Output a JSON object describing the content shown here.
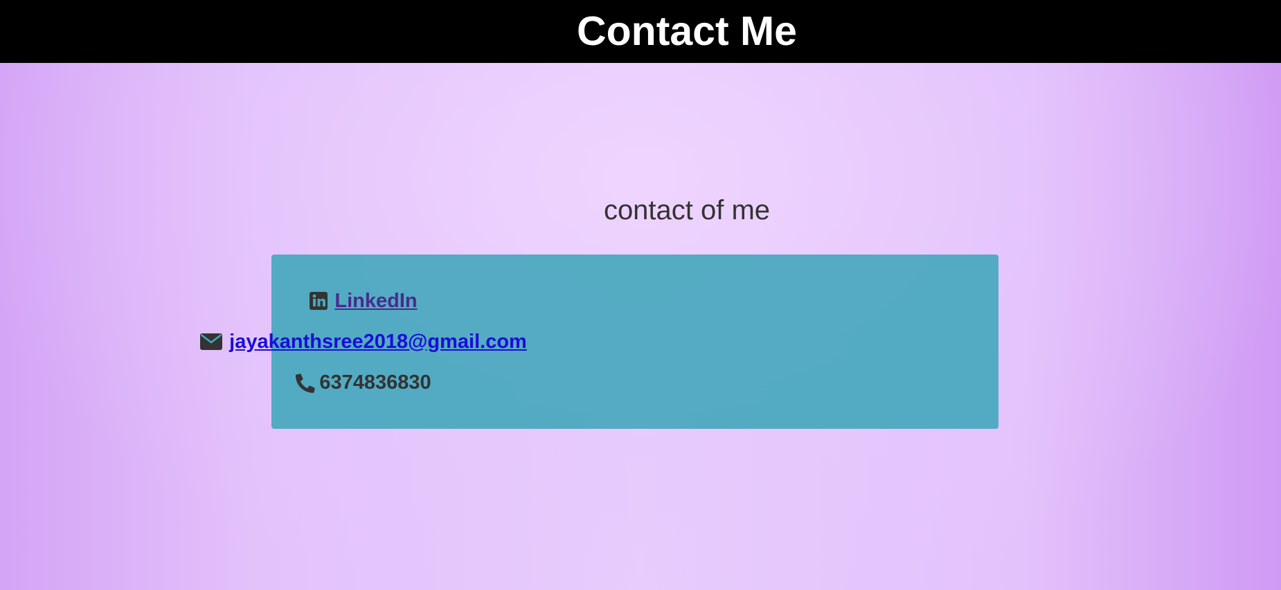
{
  "header": {
    "title": "Contact Me"
  },
  "main": {
    "subtitle": "contact of me"
  },
  "contacts": {
    "linkedin": {
      "icon": "linkedin-icon",
      "label": "LinkedIn"
    },
    "email": {
      "icon": "envelope-icon",
      "label": "jayakanthsree2018@gmail.com"
    },
    "phone": {
      "icon": "phone-icon",
      "label": "6374836830"
    }
  },
  "colors": {
    "header_bg": "#000000",
    "header_text": "#ffffff",
    "page_bg": "#e3c2fb",
    "box_bg": "#4fa9bd",
    "linkedin_link": "#4a2a8e",
    "email_link": "#1a0dd9",
    "text": "#333333"
  }
}
